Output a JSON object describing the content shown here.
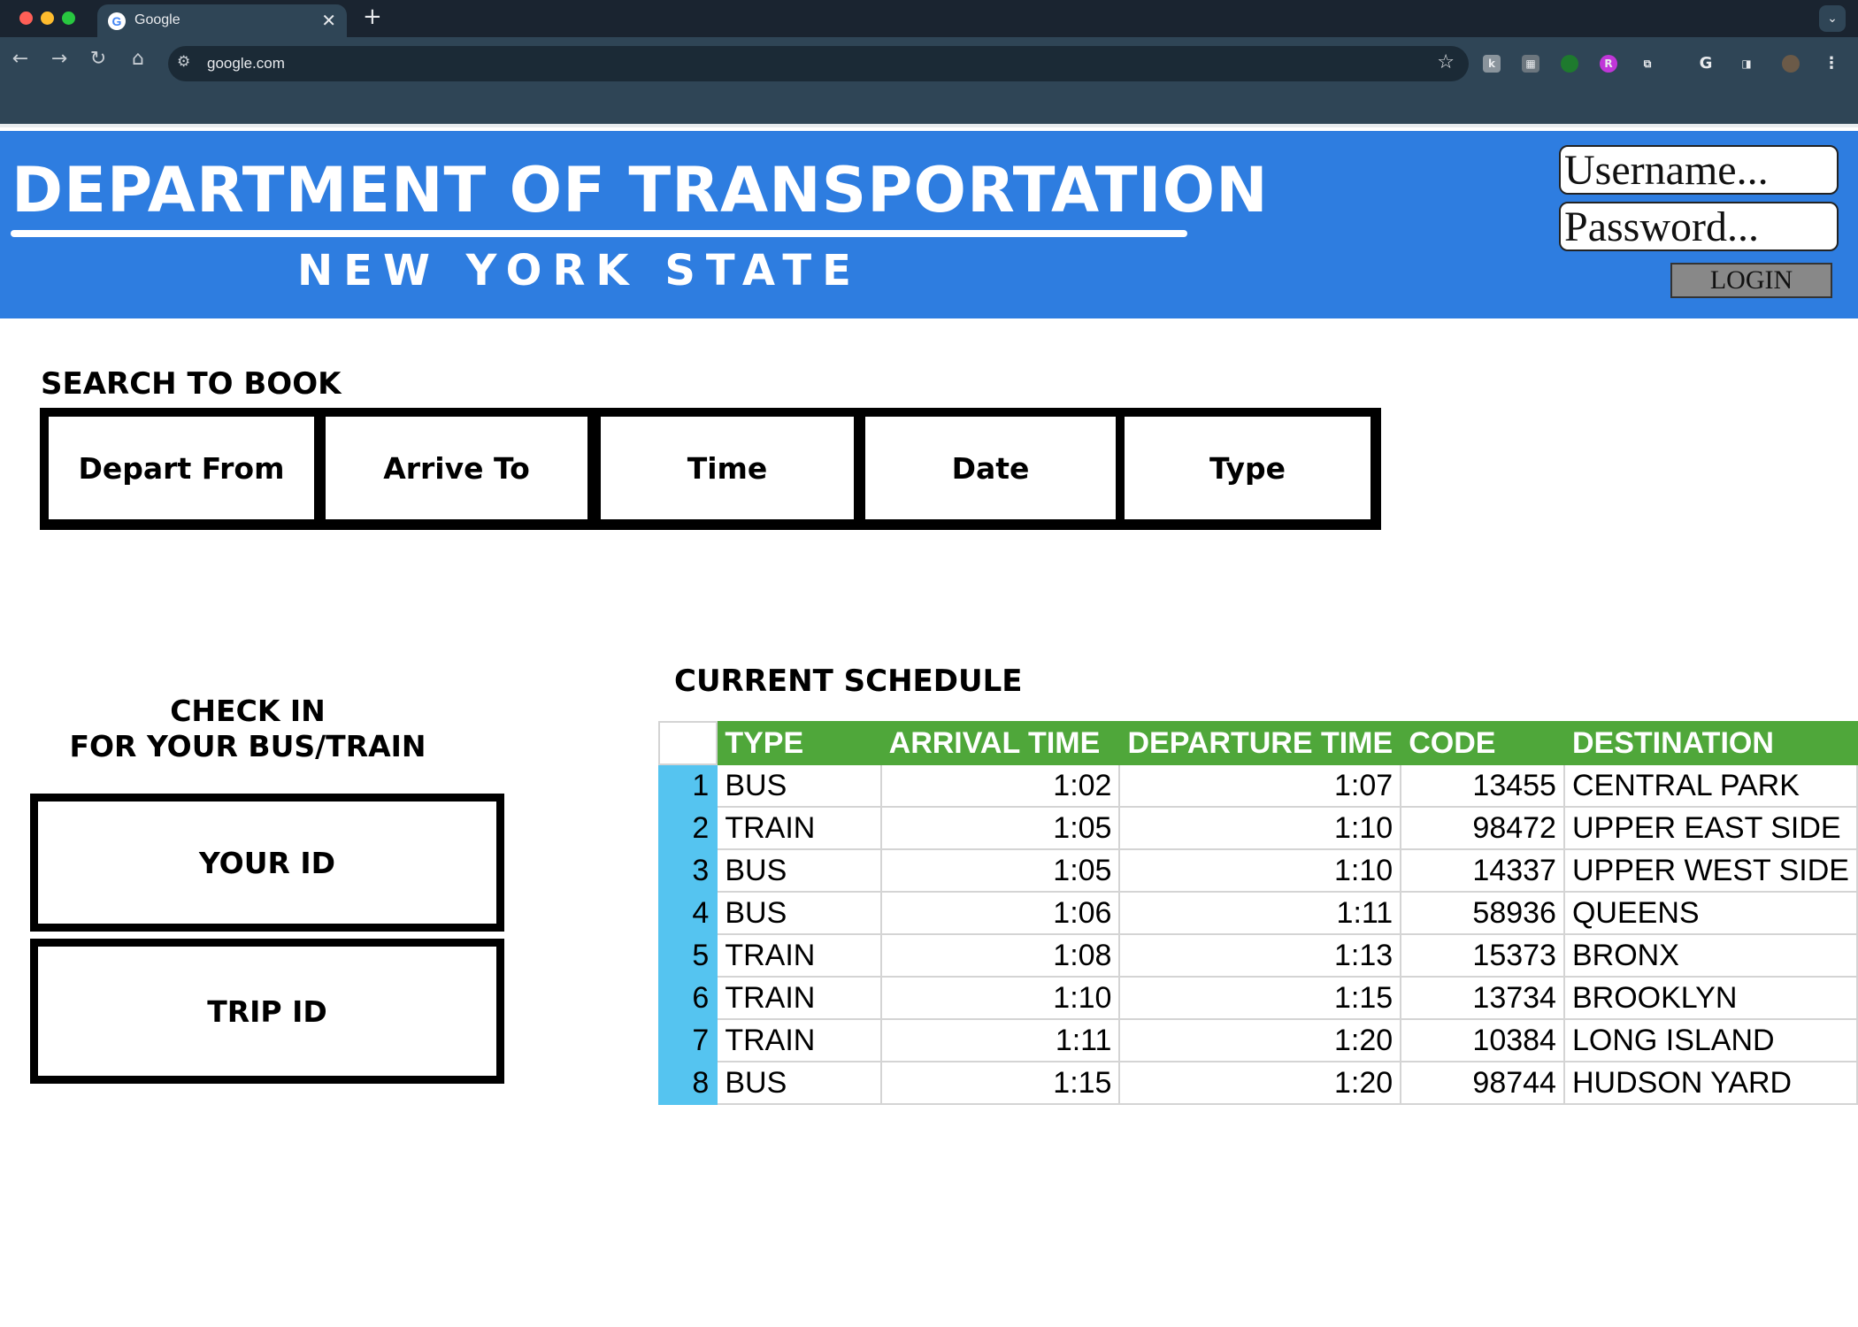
{
  "browser": {
    "tab_title": "Google",
    "tab_favicon": "G",
    "url": "google.com",
    "icons": [
      "back-icon",
      "forward-icon",
      "reload-icon",
      "home-icon",
      "site-settings-icon",
      "bookmark-star-icon",
      "extension-icons",
      "profile-avatar",
      "kebab-menu-icon"
    ]
  },
  "header": {
    "title": "DEPARTMENT OF TRANSPORTATION",
    "subtitle": "NEW YORK STATE",
    "username_placeholder": "Username...",
    "password_placeholder": "Password...",
    "login_label": "LOGIN",
    "background_color": "#2e7de0"
  },
  "search": {
    "title": "SEARCH TO BOOK",
    "fields": [
      "Depart From",
      "Arrive To",
      "Time",
      "Date",
      "Type"
    ]
  },
  "checkin": {
    "title_line1": "CHECK IN",
    "title_line2": "FOR YOUR BUS/TRAIN",
    "your_id_label": "YOUR ID",
    "trip_id_label": "TRIP ID"
  },
  "schedule": {
    "title": "CURRENT SCHEDULE",
    "header_color": "#4fa73a",
    "rownum_color": "#55c4f0",
    "columns": [
      "TYPE",
      "ARRIVAL TIME",
      "DEPARTURE TIME",
      "CODE",
      "DESTINATION"
    ],
    "rows": [
      {
        "n": "1",
        "type": "BUS",
        "arrival": "1:02",
        "departure": "1:07",
        "code": "13455",
        "destination": "CENTRAL PARK"
      },
      {
        "n": "2",
        "type": "TRAIN",
        "arrival": "1:05",
        "departure": "1:10",
        "code": "98472",
        "destination": "UPPER EAST SIDE"
      },
      {
        "n": "3",
        "type": "BUS",
        "arrival": "1:05",
        "departure": "1:10",
        "code": "14337",
        "destination": "UPPER WEST SIDE"
      },
      {
        "n": "4",
        "type": "BUS",
        "arrival": "1:06",
        "departure": "1:11",
        "code": "58936",
        "destination": "QUEENS"
      },
      {
        "n": "5",
        "type": "TRAIN",
        "arrival": "1:08",
        "departure": "1:13",
        "code": "15373",
        "destination": "BRONX"
      },
      {
        "n": "6",
        "type": "TRAIN",
        "arrival": "1:10",
        "departure": "1:15",
        "code": "13734",
        "destination": "BROOKLYN"
      },
      {
        "n": "7",
        "type": "TRAIN",
        "arrival": "1:11",
        "departure": "1:20",
        "code": "10384",
        "destination": "LONG ISLAND"
      },
      {
        "n": "8",
        "type": "BUS",
        "arrival": "1:15",
        "departure": "1:20",
        "code": "98744",
        "destination": "HUDSON YARD"
      }
    ]
  }
}
